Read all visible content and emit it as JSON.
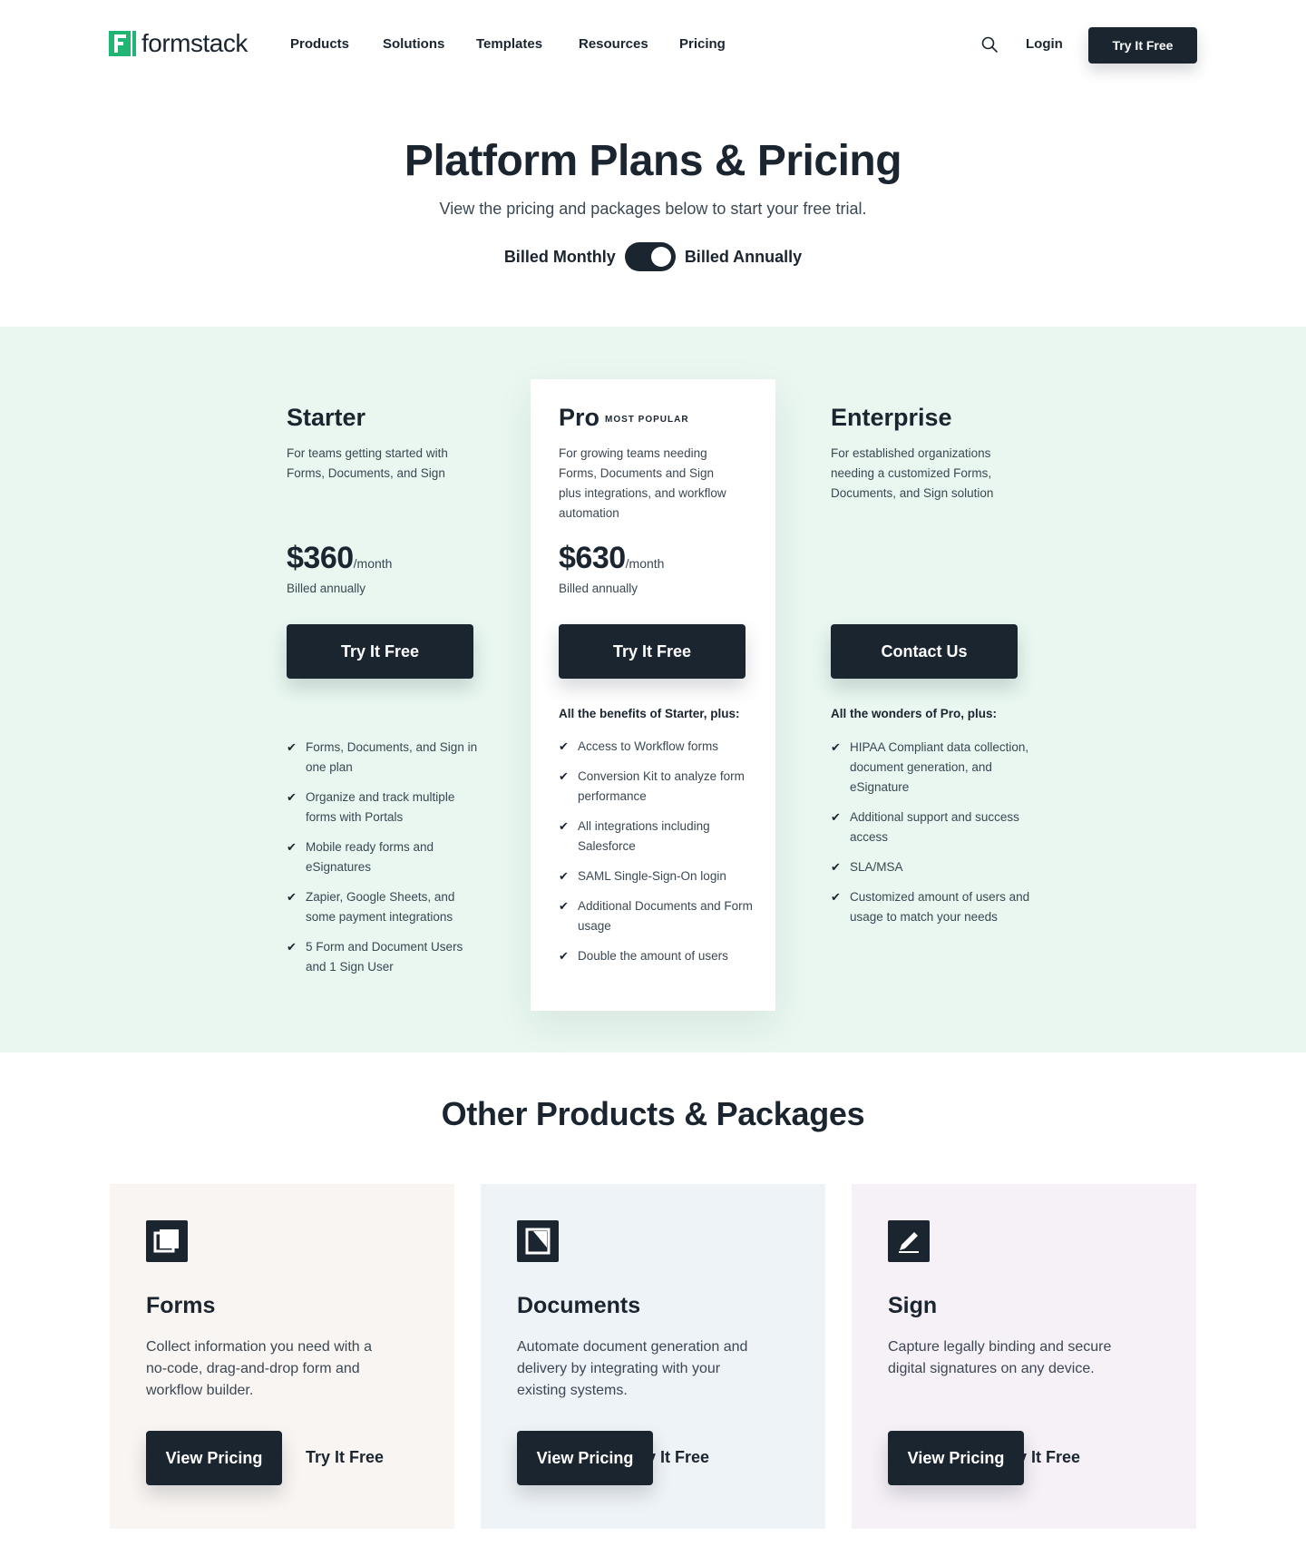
{
  "header": {
    "logo_text": "formstack",
    "nav": [
      "Products",
      "Solutions",
      "Templates",
      "Resources",
      "Pricing"
    ],
    "login": "Login",
    "cta": "Try It Free"
  },
  "hero": {
    "title": "Platform Plans & Pricing",
    "subtitle": "View the pricing and packages below to start your free trial.",
    "billed_monthly": "Billed Monthly",
    "billed_annually": "Billed Annually"
  },
  "plans": {
    "starter": {
      "name": "Starter",
      "description": "For teams getting started with Forms, Documents, and Sign",
      "price": "$360",
      "per": "/month",
      "billed": "Billed annually",
      "button": "Try It Free",
      "features": [
        "Forms, Documents, and Sign in one plan",
        "Organize and track multiple forms with Portals",
        "Mobile ready forms and eSignatures",
        "Zapier, Google Sheets, and some payment integrations",
        "5 Form and Document Users and 1 Sign User"
      ]
    },
    "pro": {
      "name": "Pro",
      "badge": "MOST POPULAR",
      "description": "For growing teams needing Forms, Documents and Sign plus integrations, and workflow automation",
      "price": "$630",
      "per": "/month",
      "billed": "Billed annually",
      "button": "Try It Free",
      "intro": "All the benefits of Starter, plus:",
      "features": [
        "Access to Workflow forms",
        "Conversion Kit to analyze form performance",
        "All integrations including Salesforce",
        "SAML Single-Sign-On login",
        "Additional Documents and Form usage",
        "Double the amount of users"
      ]
    },
    "enterprise": {
      "name": "Enterprise",
      "description": "For established organizations needing a customized Forms, Documents, and Sign solution",
      "button": "Contact Us",
      "intro": "All the wonders of Pro, plus:",
      "features": [
        "HIPAA Compliant data collection, document generation, and eSignature",
        "Additional support and success access",
        "SLA/MSA",
        "Customized amount of users and usage to match your needs"
      ]
    }
  },
  "other": {
    "title": "Other Products & Packages",
    "products": [
      {
        "icon": "forms-icon",
        "title": "Forms",
        "description": "Collect information you need with a no-code, drag-and-drop form and workflow builder.",
        "view": "View Pricing",
        "try": "Try It Free"
      },
      {
        "icon": "documents-icon",
        "title": "Documents",
        "description": "Automate document generation and delivery by integrating with your existing systems.",
        "view": "View Pricing",
        "try": "Try It Free"
      },
      {
        "icon": "sign-icon",
        "title": "Sign",
        "description": "Capture legally binding and secure digital signatures on any device.",
        "view": "View Pricing",
        "try": "Try It Free"
      }
    ]
  },
  "colors": {
    "dark": "#1b2530",
    "brand_green": "#21b573",
    "band_bg": "#e9f7f0",
    "forms_bg": "#f9f5f2",
    "documents_bg": "#eef3f7",
    "sign_bg": "#f6f0f7"
  }
}
